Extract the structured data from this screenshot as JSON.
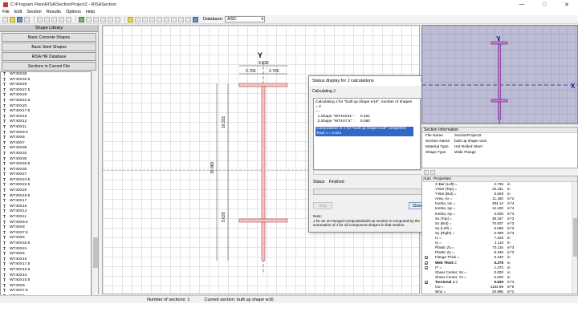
{
  "window": {
    "title": "C:\\Program Files\\RISA\\SectionProject2 - RISASection",
    "minimize": "—",
    "maximize": "□",
    "close": "✕"
  },
  "menu": [
    "File",
    "Edit",
    "Section",
    "Results",
    "Options",
    "Help"
  ],
  "toolbar": {
    "database_label": "Database:",
    "database_value": "AISC"
  },
  "left_panel": {
    "header": "Shape Library",
    "buttons": [
      "Basic Concrete Shapes",
      "Basic Steel Shapes",
      "RISA HR Database",
      "Sections in Current File"
    ],
    "shapes": [
      "WT40X36",
      "WT40X32.5",
      "WT40X29",
      "WT40X27.5",
      "WT40X25",
      "WT40X22.5",
      "WT40X20",
      "WT40X17.5",
      "WT40X15",
      "WT40X13",
      "WT40X11",
      "WT40X9.5",
      "WT40X8",
      "WT40X7",
      "WT40X36",
      "WT40X33",
      "WT40X30",
      "WT40X26.5",
      "WT40X30",
      "WT40X27",
      "WT40X24.5",
      "WT40X22.5",
      "WT40X20",
      "WT40X19.5",
      "WT40X17",
      "WT40X15",
      "WT40X13",
      "WT40X11",
      "WT40X9.5",
      "WT40X8",
      "WT40X7.5",
      "WT40X6",
      "WT40X33.5",
      "WT40X24",
      "WT40X6",
      "WT40X19",
      "WT40X17.5",
      "WT40X15.5",
      "WT40X13",
      "WT40X10.5",
      "WT40X9",
      "WT40X7.5",
      "WT40X6",
      "WT40X5",
      "WT40X12.5",
      "WT40X10",
      "WT40X7.5"
    ]
  },
  "drawing": {
    "y_axis": "Y",
    "dim_total_width": "5.530",
    "dim_half_left": "2.765",
    "dim_half_right": "2.765",
    "dim_upper": "10.331",
    "dim_total_height": "15.960",
    "dim_lower": "5.629"
  },
  "dialog": {
    "title": "Status display for J calculations",
    "close": "✕",
    "calculating": "Calculating J",
    "lines": [
      "Calculating J for \"built up shape w16\", number of shapes",
      "= 2",
      "---",
      "",
      "  1.Shape \"WT40X31\" :     0.461",
      "  2.Shape \"WT4X7.5\"  :     0.060"
    ],
    "highlight_1": "Computation of J for \"built up shape w16\" completed",
    "highlight_2": "Total J   =    0.521",
    "status_label": "Status:",
    "status_value": "Finished",
    "stop_btn": "Stop",
    "close_btn": "Close",
    "note_label": "Note:",
    "note_text": "J for an un-merged composite/built-up section is computed by the summation of J for all component shapes in that section."
  },
  "preview": {
    "y_label": "Y",
    "x_label": "X"
  },
  "section_info": {
    "header": "Section Information",
    "rows": [
      {
        "k": "File Name",
        "v": "SectionProject2"
      },
      {
        "k": "Section Name",
        "v": "built up shape w16"
      },
      {
        "k": "Material Type",
        "v": "Hot Rolled Steel"
      },
      {
        "k": "Shape Type",
        "v": "Wide Flange"
      }
    ]
  },
  "properties": {
    "header_col1": "Auto",
    "header_col2": "Properties",
    "rows": [
      {
        "n": "X-Bar (Left) =",
        "v": "2.765",
        "u": "in",
        "cb": ""
      },
      {
        "n": "Y-Bar (Top) =",
        "v": "10.331",
        "u": "in",
        "cb": ""
      },
      {
        "n": "Y-Bar (Bot) =",
        "v": "5.629",
        "u": "in",
        "cb": ""
      },
      {
        "n": "Area, Ax =",
        "v": "11.250",
        "u": "in^2",
        "cb": ""
      },
      {
        "n": "Inertia, Ixx =",
        "v": "394.14",
        "u": "in^4",
        "cb": ""
      },
      {
        "n": "Inertia, Iyy =",
        "v": "14.100",
        "u": "in^4",
        "cb": ""
      },
      {
        "n": "Inertia, Ixy =",
        "v": "0.000",
        "u": "in^4",
        "cb": ""
      },
      {
        "n": "Sx (Top) =",
        "v": "38.157",
        "u": "in^3",
        "cb": ""
      },
      {
        "n": "Sx (Bot) =",
        "v": "70.007",
        "u": "in^3",
        "cb": ""
      },
      {
        "n": "Sy (Left) =",
        "v": "5.099",
        "u": "in^3",
        "cb": ""
      },
      {
        "n": "Sy (Right) =",
        "v": "5.099",
        "u": "in^3",
        "cb": ""
      },
      {
        "n": "rx =",
        "v": "7.226",
        "u": "in",
        "cb": ""
      },
      {
        "n": "ry =",
        "v": "1.115",
        "u": "in",
        "cb": ""
      },
      {
        "n": "Plastic Zx =",
        "v": "73.115",
        "u": "in^3",
        "cb": ""
      },
      {
        "n": "Plastic Zy =",
        "v": "8.340",
        "u": "in^3",
        "cb": ""
      },
      {
        "n": "Flange Thick =",
        "v": "0.440",
        "u": "in",
        "cb": "x"
      },
      {
        "n": "Web Thick =",
        "v": "0.275",
        "u": "in",
        "cb": "x",
        "bold": true
      },
      {
        "n": "rT =",
        "v": "1.370",
        "u": "in",
        "cb": "x"
      },
      {
        "n": "Shear Center, Xs =",
        "v": "0.000",
        "u": "in",
        "cb": ""
      },
      {
        "n": "Shear Center, Ys =",
        "v": "0.000",
        "u": "in",
        "cb": ""
      },
      {
        "n": "Torsional J =",
        "v": "0.529",
        "u": "in^4",
        "cb": "x",
        "bold": true
      },
      {
        "n": "Cw =",
        "v": "1184.99",
        "u": "in^6",
        "cb": ""
      },
      {
        "n": "Wno =",
        "v": "20.986",
        "u": "in^2",
        "cb": ""
      },
      {
        "n": "Sw =",
        "v": "16.416",
        "u": "in^4",
        "cb": ""
      },
      {
        "n": "Qf =",
        "v": "21.284",
        "u": "in^3",
        "cb": ""
      },
      {
        "n": "Qw =",
        "v": "36.260",
        "u": "in^3",
        "cb": ""
      }
    ]
  },
  "status_bar": {
    "num_sections": "Number of sections: 1",
    "current_section": "Current section: built up shape w16"
  }
}
